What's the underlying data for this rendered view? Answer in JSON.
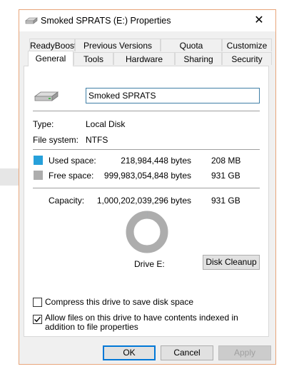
{
  "window": {
    "title": "Smoked SPRATS (E:) Properties",
    "close_glyph": "✕"
  },
  "tabs_row1": [
    "ReadyBoost",
    "Previous Versions",
    "Quota",
    "Customize"
  ],
  "tabs_row2": [
    "General",
    "Tools",
    "Hardware",
    "Sharing",
    "Security"
  ],
  "active_tab": "General",
  "general": {
    "drive_name": "Smoked SPRATS",
    "type_label": "Type:",
    "type_value": "Local Disk",
    "fs_label": "File system:",
    "fs_value": "NTFS",
    "used_label": "Used space:",
    "used_bytes": "218,984,448 bytes",
    "used_size": "208 MB",
    "free_label": "Free space:",
    "free_bytes": "999,983,054,848 bytes",
    "free_size": "931 GB",
    "capacity_label": "Capacity:",
    "capacity_bytes": "1,000,202,039,296 bytes",
    "capacity_size": "931 GB",
    "drive_label": "Drive E:",
    "cleanup_button": "Disk Cleanup",
    "compress_label": "Compress this drive to save disk space",
    "compress_checked": false,
    "index_label": "Allow files on this drive to have contents indexed in addition to file properties",
    "index_checked": true,
    "used_fraction": 0.0002,
    "colors": {
      "used": "#26a0da",
      "free": "#adadad"
    }
  },
  "buttons": {
    "ok": "OK",
    "cancel": "Cancel",
    "apply": "Apply"
  }
}
